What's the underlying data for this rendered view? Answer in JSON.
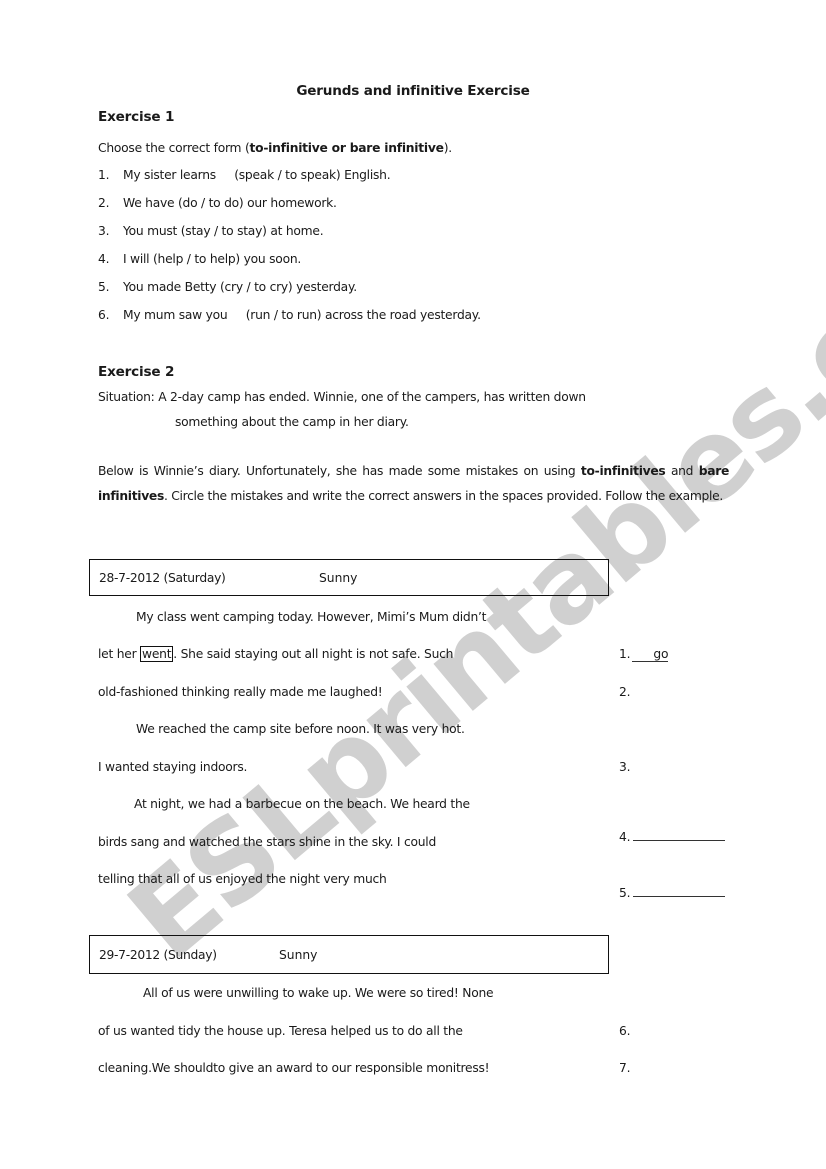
{
  "document": {
    "title": "Gerunds and infinitive Exercise",
    "watermark": "ESLprintables.com"
  },
  "exercise1": {
    "heading": "Exercise 1",
    "instruction_prefix": "Choose the correct form (",
    "instruction_bold": "to-infinitive or bare infinitive",
    "instruction_suffix": ").",
    "items": [
      {
        "num": "1.",
        "text": "My sister learns     (speak / to speak) English."
      },
      {
        "num": "2.",
        "text": "We have (do / to do) our homework."
      },
      {
        "num": "3.",
        "text": "You must (stay / to stay) at home."
      },
      {
        "num": "4.",
        "text": "I will (help / to help) you soon."
      },
      {
        "num": "5.",
        "text": "You made Betty (cry / to cry) yesterday."
      },
      {
        "num": "6.",
        "text": "My mum saw you     (run / to run) across the road yesterday."
      }
    ]
  },
  "exercise2": {
    "heading": "Exercise 2",
    "situation_line1": "Situation: A 2-day camp has ended. Winnie, one of the campers, has written down",
    "situation_line2": "something about the camp in her diary.",
    "instructions": {
      "part1": "Below is Winnie’s diary. Unfortunately, she has made some mistakes on using ",
      "bold1": "to-infinitives",
      "part2": " and ",
      "bold2": "bare infinitives",
      "part3": ". Circle the mistakes and write the correct answers in the spaces provided. Follow the example."
    },
    "diary": [
      {
        "date": "28-7-2012 (Saturday)",
        "weather": "Sunny",
        "lines": [
          "My class went camping today. However, Mimi’s Mum didn’t",
          {
            "before": "let her ",
            "circled": "went",
            "after": ". She said staying out all night is not safe. Such"
          },
          "old-fashioned thinking really made me laughed!",
          "We reached the camp site before noon. It was very hot.",
          "I wanted staying indoors.",
          "At night, we had a barbecue on the beach. We heard the",
          "birds sang and watched the stars shine in the sky. I could",
          "telling that all of us enjoyed the night very much"
        ]
      },
      {
        "date": "29-7-2012 (Sunday)",
        "weather": "Sunny",
        "lines": [
          "All of us were unwilling to wake up. We were so tired! None",
          "of us wanted tidy the house up. Teresa helped us to do all the",
          "cleaning.We shouldto give an award to our responsible monitress!"
        ]
      }
    ],
    "answers": [
      {
        "num": "1.",
        "value": "go"
      },
      {
        "num": "2.",
        "value": ""
      },
      {
        "num": "3.",
        "value": ""
      },
      {
        "num": "4.",
        "value": ""
      },
      {
        "num": "5.",
        "value": ""
      },
      {
        "num": "6.",
        "value": ""
      },
      {
        "num": "7.",
        "value": ""
      }
    ]
  }
}
